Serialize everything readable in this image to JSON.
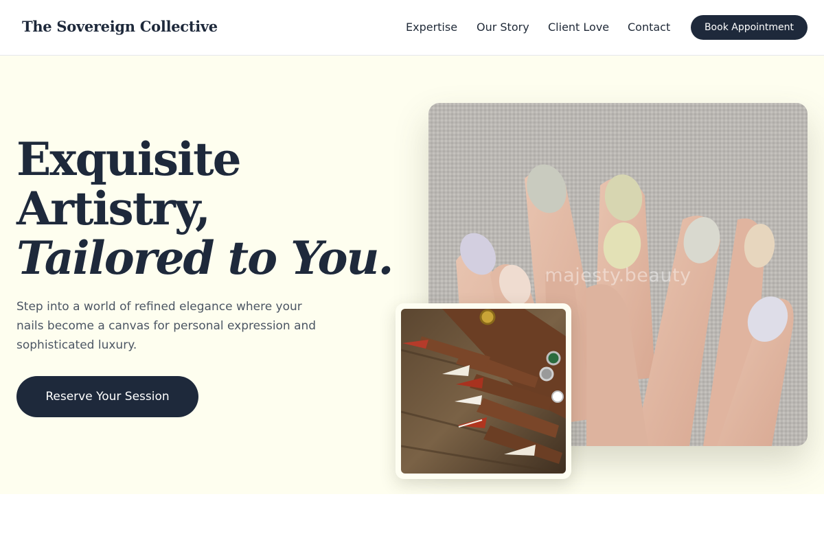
{
  "brand": {
    "name": "The Sovereign Collective"
  },
  "nav": {
    "items": [
      {
        "label": "Expertise"
      },
      {
        "label": "Our Story"
      },
      {
        "label": "Client Love"
      },
      {
        "label": "Contact"
      }
    ],
    "cta_label": "Book Appointment"
  },
  "hero": {
    "headline_line1": "Exquisite",
    "headline_line2": "Artistry,",
    "headline_line3": "Tailored to You.",
    "subtext": "Step into a world of refined elegance where your nails become a canvas for personal expression and sophisticated luxury.",
    "cta_label": "Reserve Your Session"
  },
  "images": {
    "main": {
      "description_icon": "nail-photo-pastel",
      "watermark": "majesty.beauty"
    },
    "secondary": {
      "description_icon": "nail-photo-red-art"
    }
  },
  "colors": {
    "navy": "#1e293b",
    "hero_bg": "#fefeef",
    "text_muted": "#4b5563",
    "white": "#ffffff"
  }
}
